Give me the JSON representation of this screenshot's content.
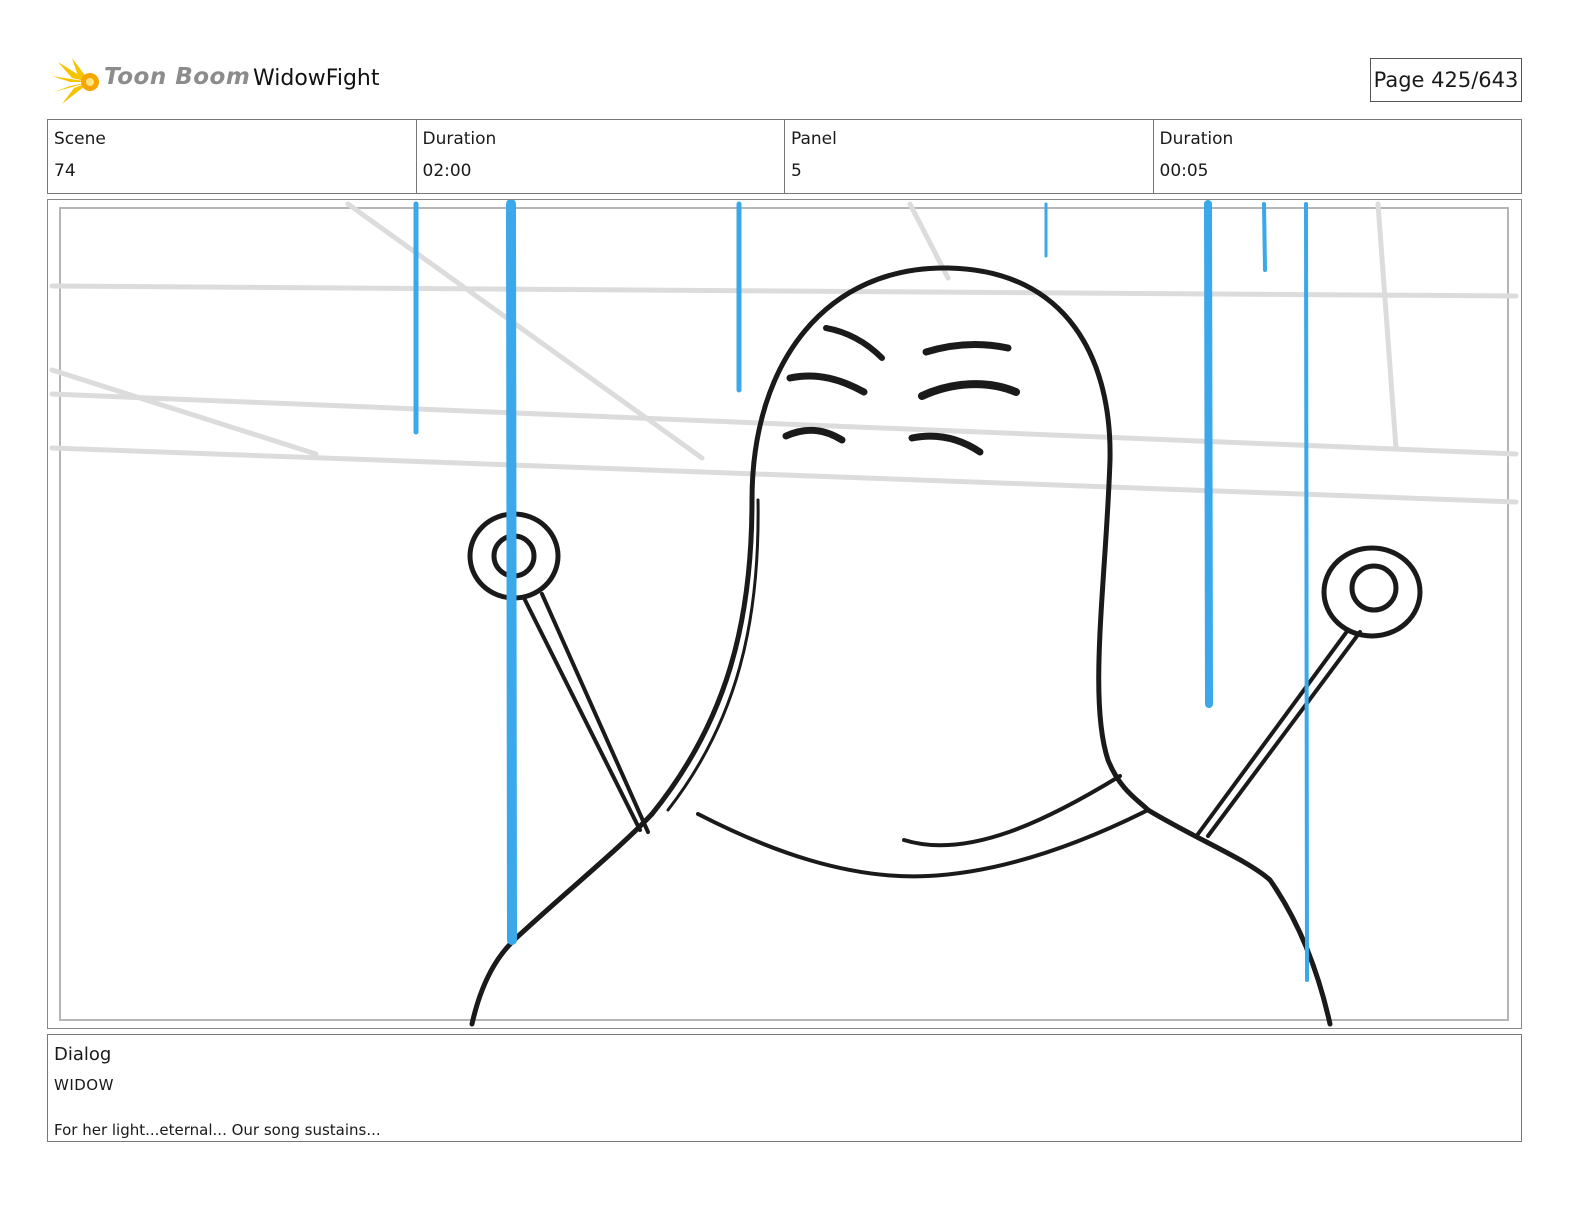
{
  "header": {
    "logo_text": "Toon Boom",
    "project_title": "WidowFight",
    "page_indicator": "Page 425/643"
  },
  "info": {
    "scene_label": "Scene",
    "scene_value": "74",
    "scene_duration_label": "Duration",
    "scene_duration_value": "02:00",
    "panel_label": "Panel",
    "panel_value": "5",
    "panel_duration_label": "Duration",
    "panel_duration_value": "00:05"
  },
  "dialog": {
    "label": "Dialog",
    "speaker": "WIDOW",
    "line": "For her light...eternal... Our song sustains..."
  },
  "colors": {
    "rain": "#3aa8ea",
    "ink": "#1a1a1a",
    "background_lines": "#dcdcdc",
    "logo_burst": "#f5c400"
  },
  "icons": {
    "logo": "toon-boom-burst-icon"
  }
}
